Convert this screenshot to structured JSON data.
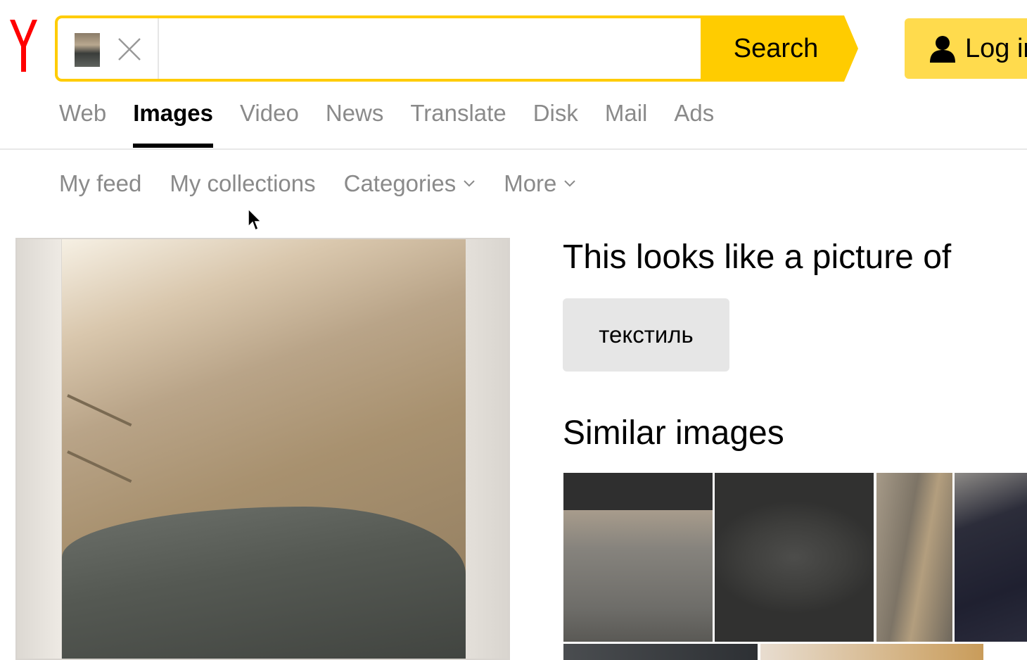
{
  "logo": {
    "letter": "Y",
    "color": "#ff0000"
  },
  "search": {
    "button_label": "Search",
    "value": "",
    "placeholder": "",
    "accent": "#ffcc00"
  },
  "login": {
    "label": "Log in"
  },
  "tabs": [
    {
      "label": "Web",
      "active": false
    },
    {
      "label": "Images",
      "active": true
    },
    {
      "label": "Video",
      "active": false
    },
    {
      "label": "News",
      "active": false
    },
    {
      "label": "Translate",
      "active": false
    },
    {
      "label": "Disk",
      "active": false
    },
    {
      "label": "Mail",
      "active": false
    },
    {
      "label": "Ads",
      "active": false
    }
  ],
  "subnav": [
    {
      "label": "My feed"
    },
    {
      "label": "My collections"
    },
    {
      "label": "Categories",
      "icon": "chevron-down-icon"
    },
    {
      "label": "More",
      "icon": "chevron-down-icon"
    }
  ],
  "result": {
    "heading": "This looks like a picture of",
    "tag": "текстиль",
    "similar_heading": "Similar images"
  },
  "colors": {
    "tab_inactive": "#8a8a8a",
    "tag_bg": "#e6e6e6",
    "login_bg": "#ffdb4d"
  }
}
